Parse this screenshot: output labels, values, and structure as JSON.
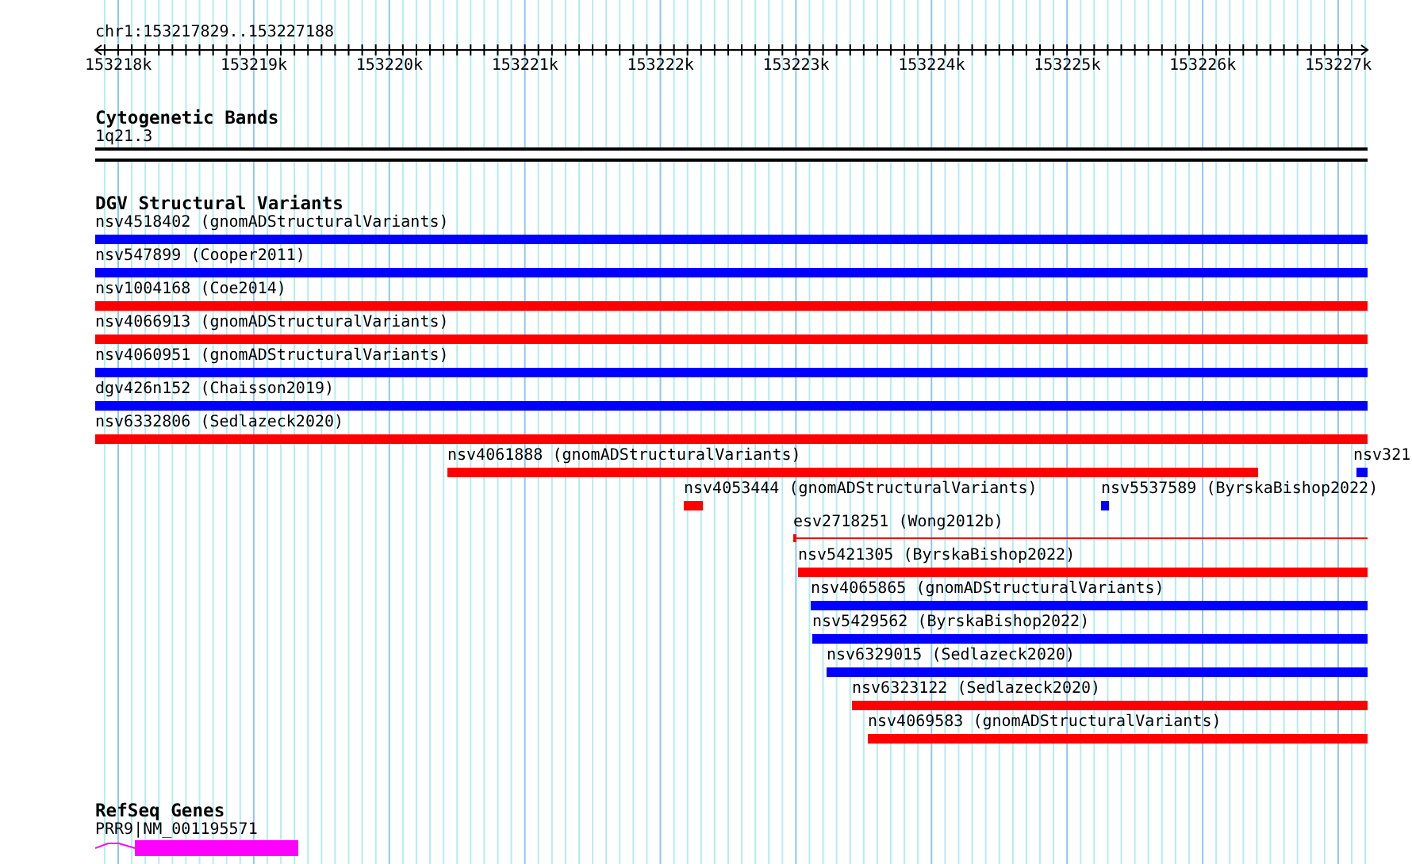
{
  "ruler": {
    "position": "chr1:153217829..153227188",
    "ticks": [
      "153218k",
      "153219k",
      "153220k",
      "153221k",
      "153222k",
      "153223k",
      "153224k",
      "153225k",
      "153226k",
      "153227k"
    ]
  },
  "tracks": [
    {
      "kind": "bands",
      "title": "Cytogenetic Bands",
      "features": [
        {
          "label": "1q21.3"
        }
      ]
    },
    {
      "kind": "variants",
      "title": "DGV Structural Variants",
      "rows": [
        [
          {
            "label": "nsv4518402 (gnomADStructuralVariants)",
            "color": "#0000ff",
            "kind": "block"
          }
        ],
        [
          {
            "label": "nsv547899 (Cooper2011)",
            "color": "#0000ff",
            "kind": "block"
          }
        ],
        [
          {
            "label": "nsv1004168 (Coe2014)",
            "color": "#ff0000",
            "kind": "block"
          }
        ],
        [
          {
            "label": "nsv4066913 (gnomADStructuralVariants)",
            "color": "#ff0000",
            "kind": "block"
          }
        ],
        [
          {
            "label": "nsv4060951 (gnomADStructuralVariants)",
            "color": "#0000ff",
            "kind": "block"
          }
        ],
        [
          {
            "label": "dgv426n152 (Chaisson2019)",
            "color": "#0000ff",
            "kind": "block"
          }
        ],
        [
          {
            "label": "nsv6332806 (Sedlazeck2020)",
            "color": "#ff0000",
            "kind": "block"
          }
        ],
        [
          {
            "label": "nsv4061888 (gnomADStructuralVariants)",
            "color": "#ff0000",
            "kind": "block"
          },
          {
            "label": "nsv321",
            "color": "#0000ff",
            "kind": "block"
          }
        ],
        [
          {
            "label": "nsv4053444 (gnomADStructuralVariants)",
            "color": "#ff0000",
            "kind": "block"
          },
          {
            "label": "nsv5537589 (ByrskaBishop2022)",
            "color": "#0000ff",
            "kind": "block"
          }
        ],
        [
          {
            "label": "esv2718251 (Wong2012b)",
            "color": "#ff0000",
            "kind": "line"
          }
        ],
        [
          {
            "label": "nsv5421305 (ByrskaBishop2022)",
            "color": "#ff0000",
            "kind": "block"
          }
        ],
        [
          {
            "label": "nsv4065865 (gnomADStructuralVariants)",
            "color": "#0000ff",
            "kind": "block"
          }
        ],
        [
          {
            "label": "nsv5429562 (ByrskaBishop2022)",
            "color": "#0000ff",
            "kind": "block"
          }
        ],
        [
          {
            "label": "nsv6329015 (Sedlazeck2020)",
            "color": "#0000ff",
            "kind": "block"
          }
        ],
        [
          {
            "label": "nsv6323122 (Sedlazeck2020)",
            "color": "#ff0000",
            "kind": "block"
          }
        ],
        [
          {
            "label": "nsv4069583 (gnomADStructuralVariants)",
            "color": "#ff0000",
            "kind": "block"
          }
        ]
      ]
    },
    {
      "kind": "genes",
      "title": "RefSeq Genes",
      "features": [
        {
          "label": "PRR9|NM_001195571"
        }
      ]
    }
  ]
}
